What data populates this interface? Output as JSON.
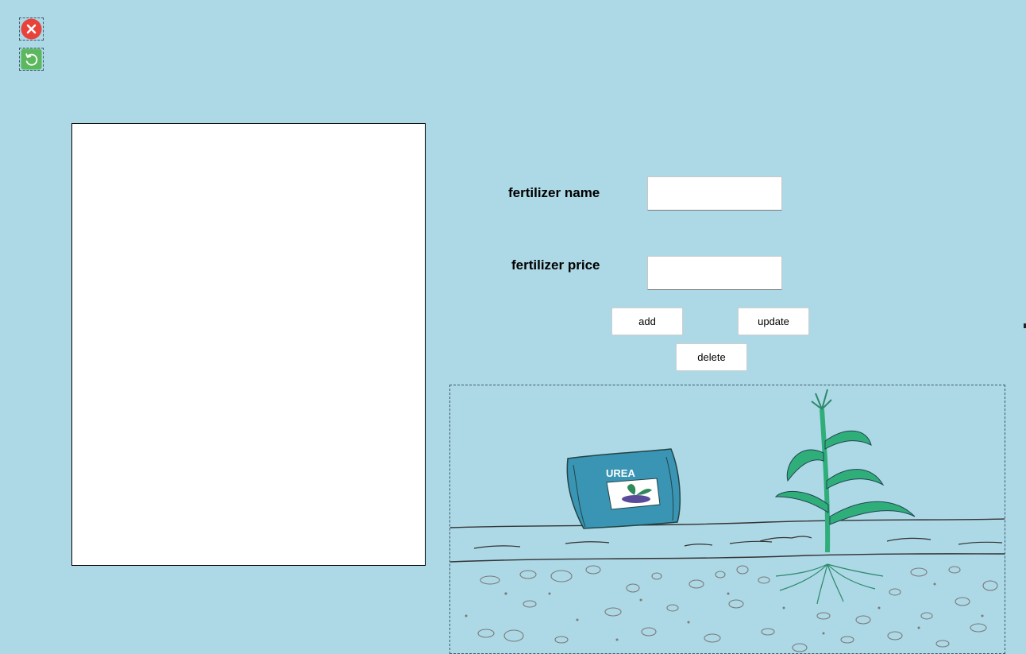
{
  "toolbar": {
    "close_icon": "close-icon",
    "refresh_icon": "refresh-icon",
    "close_color": "#e8423a",
    "refresh_color": "#5cb85c"
  },
  "list": {
    "items": []
  },
  "form": {
    "name_label": "fertilizer name",
    "name_value": "",
    "price_label": "fertilizer price",
    "price_value": ""
  },
  "buttons": {
    "add": "add",
    "update": "update",
    "delete": "delete"
  },
  "illustration": {
    "bag_text": "UREA",
    "bag_color": "#3a95b4",
    "plant_color": "#2fae7a",
    "soil_line_color": "#333333",
    "stones_color": "#7a7a7a"
  },
  "colors": {
    "background": "#add8e6"
  }
}
